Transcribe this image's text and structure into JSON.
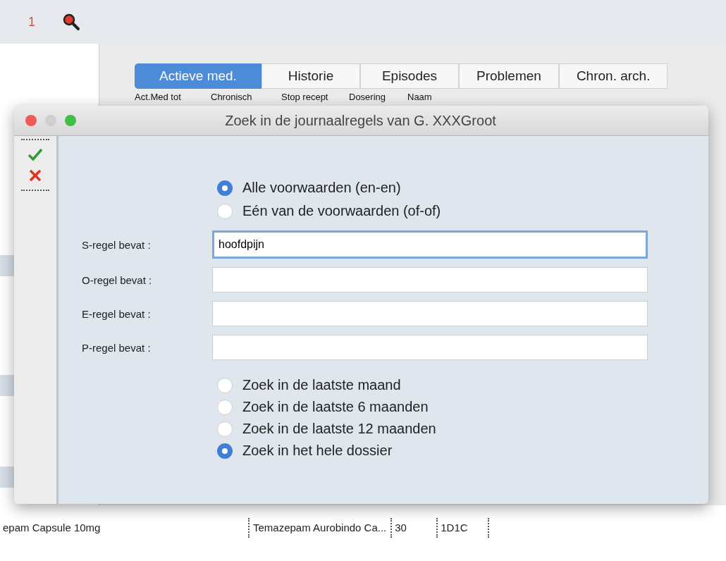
{
  "background_window": {
    "counter": "1",
    "tabs": [
      {
        "label": "Actieve med.",
        "selected": true
      },
      {
        "label": "Historie",
        "selected": false
      },
      {
        "label": "Episodes",
        "selected": false
      },
      {
        "label": "Problemen",
        "selected": false
      },
      {
        "label": "Chron. arch.",
        "selected": false
      }
    ],
    "header_bar": [
      "Act.Med tot",
      "Chronisch",
      "Stop recept",
      "Dosering",
      "Naam"
    ],
    "lower_list": [
      {
        "cells": [
          "epam Capsule 10mg",
          "Temazepam Aurobindo Ca...",
          "30",
          "1D1C"
        ]
      }
    ]
  },
  "dialog": {
    "title": "Zoek in de journaalregels van G.  XXXGroot",
    "match_options": [
      {
        "label": "Alle voorwaarden (en-en)",
        "selected": true
      },
      {
        "label": "Eén van de voorwaarden (of-of)",
        "selected": false
      }
    ],
    "fields": [
      {
        "label": "S-regel bevat :",
        "value": "hoofdpijn",
        "focused": true
      },
      {
        "label": "O-regel bevat :",
        "focused": false
      },
      {
        "label": "E-regel bevat :",
        "focused": false
      },
      {
        "label": "P-regel bevat :",
        "focused": false
      }
    ],
    "period_options": [
      {
        "label": "Zoek in de laatste maand",
        "selected": false
      },
      {
        "label": "Zoek in de laatste 6 maanden",
        "selected": false
      },
      {
        "label": "Zoek in de laatste 12 maanden",
        "selected": false
      },
      {
        "label": "Zoek in het hele dossier",
        "selected": true
      }
    ]
  }
}
